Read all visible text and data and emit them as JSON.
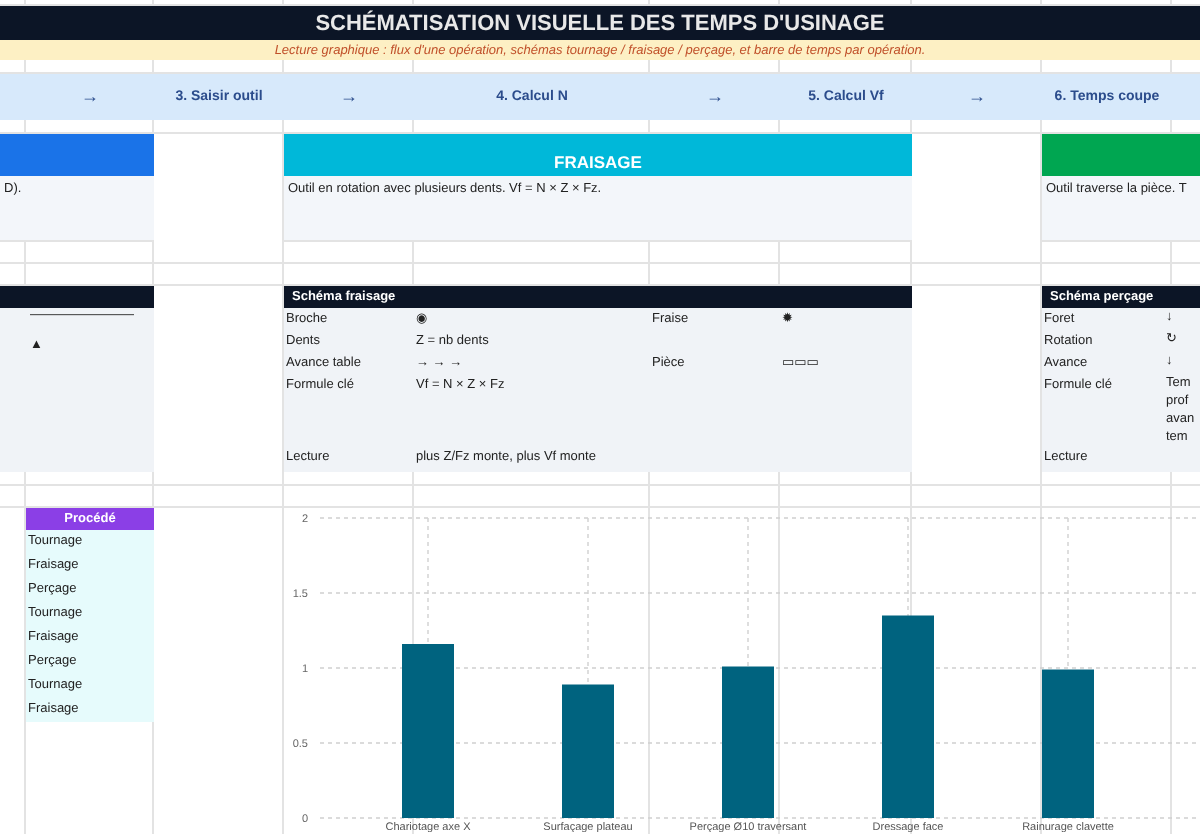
{
  "title": "SCHÉMATISATION VISUELLE DES TEMPS D'USINAGE",
  "subtitle": "Lecture graphique : flux d'une opération, schémas tournage / fraisage / perçage, et barre de temps par opération.",
  "flow": [
    {
      "kind": "arrow",
      "text": "→"
    },
    {
      "kind": "step",
      "text": "3. Saisir outil"
    },
    {
      "kind": "arrow",
      "text": "→"
    },
    {
      "kind": "step",
      "text": "4. Calcul N"
    },
    {
      "kind": "arrow",
      "text": "→"
    },
    {
      "kind": "step",
      "text": "5. Calcul Vf"
    },
    {
      "kind": "arrow",
      "text": "→"
    },
    {
      "kind": "step",
      "text": "6. Temps coupe"
    }
  ],
  "sections": [
    {
      "color": "#1a73e8",
      "description": "D)."
    },
    {
      "title": "FRAISAGE",
      "color": "#00b8d9",
      "description": "Outil en rotation avec plusieurs dents. Vf = N × Z × Fz."
    },
    {
      "color": "#00a651",
      "description": "Outil traverse la pièce. T"
    }
  ],
  "schemas": [
    {
      "kind": "marks",
      "rows": [
        {
          "cells": [
            "————————"
          ]
        },
        {
          "cells": [
            "▲"
          ]
        }
      ]
    },
    {
      "kind": "table",
      "title": "Schéma fraisage",
      "rows": [
        {
          "cells": [
            "Broche",
            "◉",
            "Fraise",
            "✹"
          ]
        },
        {
          "cells": [
            "Dents",
            "Z = nb dents"
          ]
        },
        {
          "cells": [
            "Avance table",
            "→ → →",
            "Pièce",
            "▭▭▭"
          ]
        },
        {
          "cells": [
            "Formule clé",
            "Vf = N × Z × Fz"
          ]
        },
        {
          "cells": [
            "Lecture",
            "plus Z/Fz monte, plus Vf monte"
          ]
        }
      ]
    },
    {
      "kind": "table",
      "title": "Schéma perçage",
      "rows": [
        {
          "cells": [
            "Foret",
            "↓"
          ]
        },
        {
          "cells": [
            "Rotation",
            "↻"
          ]
        },
        {
          "cells": [
            "Avance",
            "↓"
          ]
        },
        {
          "cells": [
            "Formule clé",
            "Tem prof avan tem"
          ]
        },
        {
          "cells": [
            "Lecture"
          ]
        }
      ]
    }
  ],
  "process": {
    "header": "Procédé",
    "items": [
      "Tournage",
      "Fraisage",
      "Perçage",
      "Tournage",
      "Fraisage",
      "Perçage",
      "Tournage",
      "Fraisage"
    ]
  },
  "chart": {
    "chart_data": {
      "type": "bar",
      "categories": [
        "Chariotage axe X",
        "Surfaçage plateau",
        "Perçage Ø10 traversant",
        "Dressage face",
        "Rainurage clavette"
      ],
      "series": [
        {
          "color": "#00637f",
          "values": [
            1.16,
            0.89,
            1.01,
            1.35,
            0.99
          ]
        }
      ],
      "ylim": [
        0,
        2
      ],
      "yticks": [
        0,
        0.5,
        1,
        1.5,
        2
      ],
      "grid": true
    }
  }
}
